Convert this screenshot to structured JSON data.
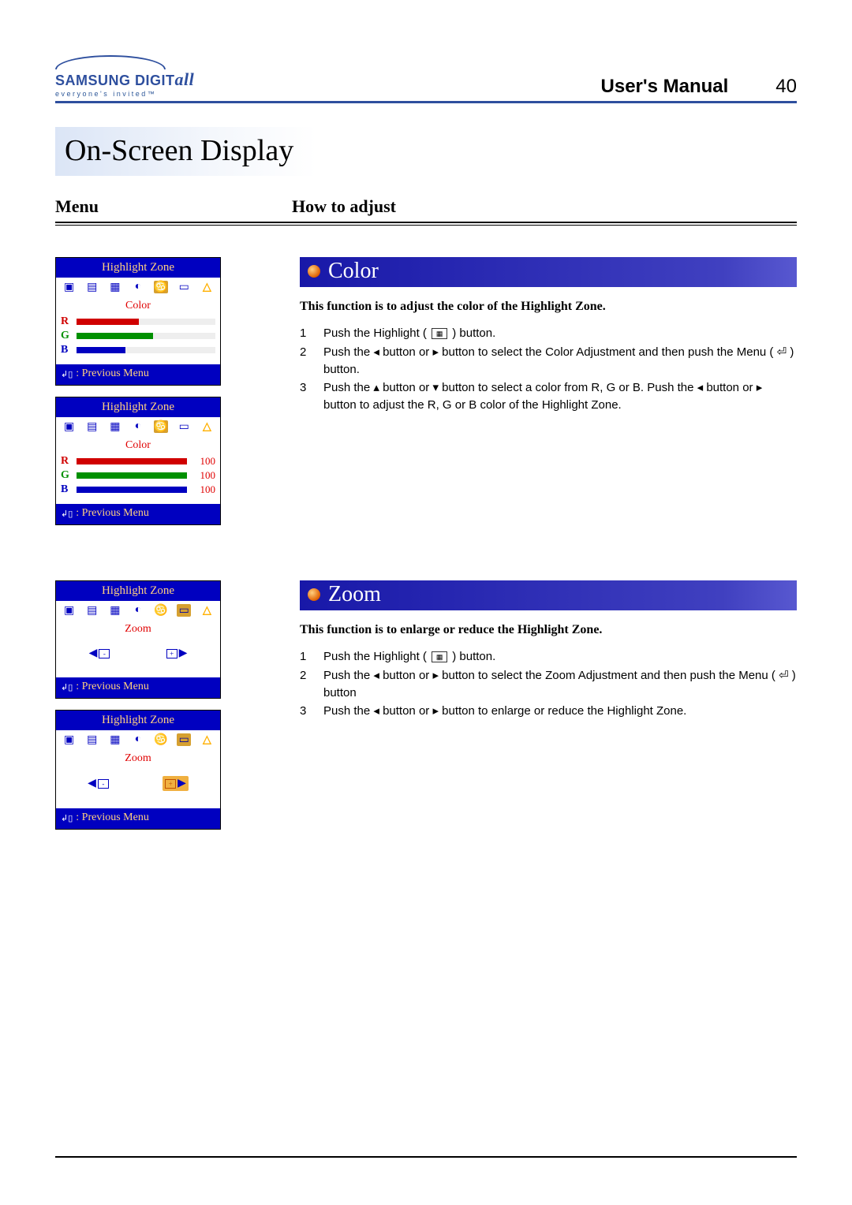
{
  "header": {
    "brand_main": "SAMSUNG DIGIT",
    "brand_suffix": "all",
    "brand_tag": "everyone's invited™",
    "manual": "User's Manual",
    "page": "40"
  },
  "page_title": "On-Screen Display",
  "cols": {
    "menu": "Menu",
    "howto": "How to adjust"
  },
  "osd": {
    "title": "Highlight Zone",
    "prev": ": Previous Menu",
    "color_label": "Color",
    "zoom_label": "Zoom",
    "color1": {
      "r_fill": 45,
      "g_fill": 55,
      "b_fill": 35
    },
    "color2": {
      "r": "100",
      "g": "100",
      "b": "100"
    }
  },
  "color_section": {
    "heading": "Color",
    "intro": "This function is to adjust the color of the Highlight Zone.",
    "steps": [
      {
        "n": "1",
        "pre": "Push the Highlight ( ",
        "mid": " ) button."
      },
      {
        "n": "2",
        "text": "Push the ◂ button or ▸ button to select the Color Adjustment and then push the Menu ( ⏎ ) button."
      },
      {
        "n": "3",
        "text": "Push the ▴ button or ▾ button to select a color from R, G or B. Push the ◂ button or ▸ button to adjust the R, G or B color of the Highlight Zone."
      }
    ]
  },
  "zoom_section": {
    "heading": "Zoom",
    "intro": "This function is to enlarge or reduce the Highlight Zone.",
    "steps": [
      {
        "n": "1",
        "pre": "Push the Highlight ( ",
        "mid": " ) button."
      },
      {
        "n": "2",
        "text": "Push the ◂ button or ▸ button to select the Zoom  Adjustment and then push the Menu ( ⏎ ) button"
      },
      {
        "n": "3",
        "text": "Push the ◂ button or ▸ button to enlarge or reduce the Highlight Zone."
      }
    ]
  }
}
